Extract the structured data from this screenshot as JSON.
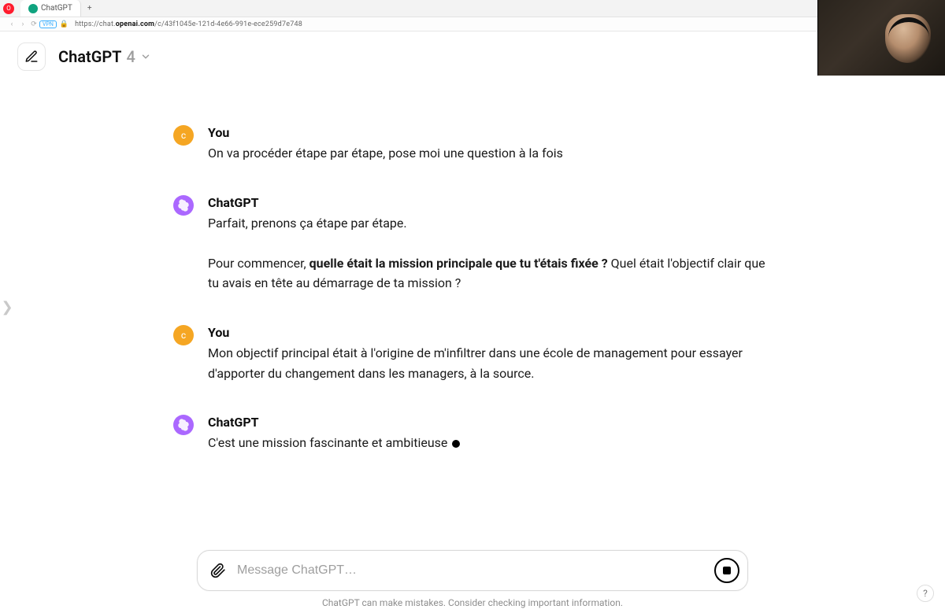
{
  "browser": {
    "tab_title": "ChatGPT",
    "url_prefix": "https://chat.",
    "url_host": "openai.com",
    "url_path": "/c/43f1045e-121d-4e66-991e-ece259d7e748",
    "new_tab_label": "+",
    "vpn_label": "VPN"
  },
  "header": {
    "model_name": "ChatGPT",
    "model_version": "4"
  },
  "labels": {
    "you": "You",
    "assistant": "ChatGPT"
  },
  "messages": {
    "m1": "On va procéder étape par étape, pose moi une question à la fois",
    "m2a": "Parfait, prenons ça étape par étape.",
    "m2b_pre": "Pour commencer, ",
    "m2b_bold": "quelle était la mission principale que tu t'étais fixée ?",
    "m2b_post": " Quel était l'objectif clair que tu avais en tête au démarrage de ta mission ?",
    "m3": "Mon objectif principal était à l'origine de m'infiltrer dans une école de management pour essayer d'apporter du changement dans les managers, à la source.",
    "m4": "C'est une mission fascinante et ambitieuse "
  },
  "composer": {
    "placeholder": "Message ChatGPT…"
  },
  "footer": {
    "disclaimer": "ChatGPT can make mistakes. Consider checking important information."
  },
  "help": "?",
  "user_avatar_letter": "c"
}
